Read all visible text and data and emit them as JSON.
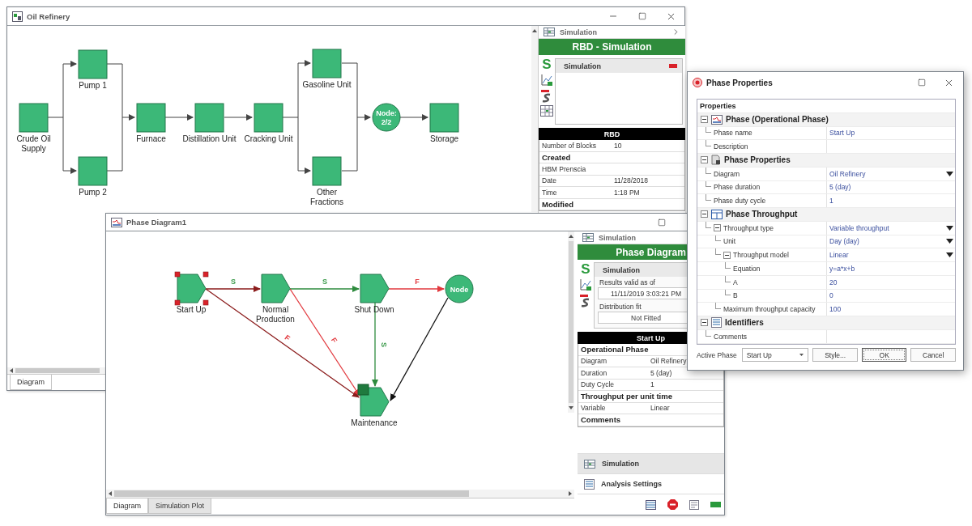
{
  "rbd_window": {
    "title": "Oil Refinery",
    "blocks": [
      {
        "lines": [
          "Crude Oil",
          "Supply"
        ]
      },
      {
        "lines": [
          "Pump 1"
        ]
      },
      {
        "lines": [
          "Pump 2"
        ]
      },
      {
        "lines": [
          "Furnace"
        ]
      },
      {
        "lines": [
          "Distillation Unit"
        ]
      },
      {
        "lines": [
          "Cracking Unit"
        ]
      },
      {
        "lines": [
          "Gasoline Unit"
        ]
      },
      {
        "lines": [
          "Other",
          "Fractions"
        ]
      },
      {
        "lines": [
          "Storage"
        ]
      }
    ],
    "node": {
      "lines": [
        "Node:",
        "2/2"
      ]
    },
    "panel": {
      "header": "Simulation",
      "banner": "RBD - Simulation",
      "tool_letter": "S",
      "list": [
        {
          "label": "Simulation",
          "color": "#d9222a"
        }
      ],
      "info": {
        "title": "RBD",
        "rows": [
          {
            "kind": "pair",
            "label": "Number of Blocks",
            "value": "10"
          },
          {
            "kind": "section",
            "label": "Created"
          },
          {
            "kind": "single",
            "label": "HBM Prenscia"
          },
          {
            "kind": "pair",
            "label": "Date",
            "value": "11/28/2018"
          },
          {
            "kind": "pair",
            "label": "Time",
            "value": "1:18 PM"
          },
          {
            "kind": "section",
            "label": "Modified"
          }
        ]
      }
    },
    "tabs": [
      {
        "label": "Diagram",
        "selected": true
      }
    ]
  },
  "phase_window": {
    "title": "Phase Diagram1",
    "phases": [
      {
        "lines": [
          "Start Up"
        ],
        "kind": "operational",
        "selected": true
      },
      {
        "lines": [
          "Normal",
          "Production"
        ],
        "kind": "operational",
        "selected": false
      },
      {
        "lines": [
          "Shut Down"
        ],
        "kind": "operational",
        "selected": false
      },
      {
        "lines": [
          "Maintenance"
        ],
        "kind": "maintenance",
        "selected": false
      }
    ],
    "node": {
      "label": "Node"
    },
    "transitions": [
      {
        "label": "S",
        "kind": "success"
      },
      {
        "label": "S",
        "kind": "success"
      },
      {
        "label": "F",
        "kind": "failure"
      },
      {
        "label": "F",
        "kind": "failure"
      },
      {
        "label": "F",
        "kind": "failure"
      },
      {
        "label": "S",
        "kind": "success"
      },
      {
        "kind": "plain"
      }
    ],
    "tabs": [
      {
        "label": "Diagram",
        "selected": true
      },
      {
        "label": "Simulation Plot",
        "selected": false
      }
    ],
    "panel": {
      "header": "Simulation",
      "banner": "Phase Diagram",
      "tool_letter": "S",
      "group": {
        "title": "Simulation",
        "fields": [
          {
            "label": "Results valid as of",
            "value": "11/11/2019 3:03:21 PM"
          },
          {
            "label": "Distribution fit",
            "value": "Not Fitted"
          }
        ]
      },
      "info": {
        "title": "Start Up",
        "rows": [
          {
            "kind": "section",
            "label": "Operational Phase"
          },
          {
            "kind": "pair",
            "label": "Diagram",
            "value": "Oil Refinery"
          },
          {
            "kind": "pair",
            "label": "Duration",
            "value": "5 (day)"
          },
          {
            "kind": "pair",
            "label": "Duty Cycle",
            "value": "1"
          },
          {
            "kind": "section",
            "label": "Throughput per unit time"
          },
          {
            "kind": "pair",
            "label": "Variable",
            "value": "Linear"
          },
          {
            "kind": "section",
            "label": "Comments"
          }
        ]
      },
      "nav": [
        {
          "label": "Simulation",
          "selected": true
        },
        {
          "label": "Analysis Settings",
          "selected": false
        }
      ]
    }
  },
  "properties_dialog": {
    "title": "Phase Properties",
    "grid_title": "Properties",
    "categories": [
      {
        "label": "Phase (Operational Phase)",
        "expanded": true,
        "rows": [
          {
            "label": "Phase name",
            "value": "Start Up",
            "dropdown": false
          },
          {
            "label": "Description",
            "dropdown": false
          }
        ]
      },
      {
        "label": "Phase Properties",
        "expanded": true,
        "rows": [
          {
            "label": "Diagram",
            "value": "Oil Refinery",
            "dropdown": true
          },
          {
            "label": "Phase duration",
            "value": "5 (day)",
            "dropdown": false
          },
          {
            "label": "Phase duty cycle",
            "value": "1",
            "dropdown": false
          }
        ]
      },
      {
        "label": "Phase Throughput",
        "expanded": true,
        "rows": [
          {
            "label": "Throughput type",
            "value": "Variable throughput",
            "dropdown": true,
            "expanded": true,
            "children": [
              {
                "label": "Unit",
                "value": "Day (day)",
                "dropdown": true
              },
              {
                "label": "Throughput model",
                "value": "Linear",
                "dropdown": true,
                "expanded": true,
                "children": [
                  {
                    "label": "Equation",
                    "value": "y=a*x+b",
                    "dropdown": false
                  },
                  {
                    "label": "A",
                    "value": "20",
                    "dropdown": false
                  },
                  {
                    "label": "B",
                    "value": "0",
                    "dropdown": false
                  }
                ]
              },
              {
                "label": "Maximum throughput capacity",
                "value": "100",
                "dropdown": false
              }
            ]
          }
        ]
      },
      {
        "label": "Identifiers",
        "expanded": true,
        "rows": [
          {
            "label": "Comments",
            "dropdown": false
          }
        ]
      }
    ],
    "active_phase": {
      "label": "Active Phase",
      "value": "Start Up"
    },
    "buttons": [
      {
        "label": "Style...",
        "default": false
      },
      {
        "label": "OK",
        "default": true
      },
      {
        "label": "Cancel",
        "default": false
      }
    ]
  }
}
